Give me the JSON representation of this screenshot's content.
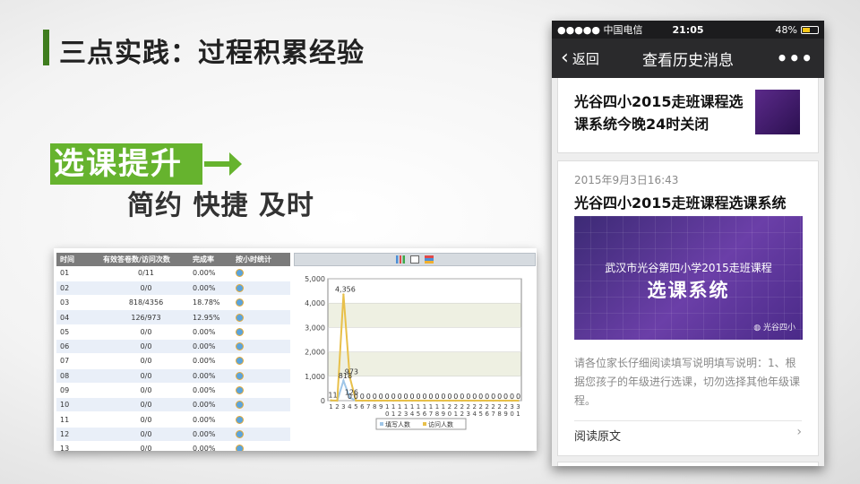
{
  "slide": {
    "title": "三点实践：过程积累经验",
    "highlight": "选课提升",
    "subtitle": "简约 快捷 及时"
  },
  "table": {
    "headers": [
      "时间",
      "有效答卷数/访问次数",
      "完成率",
      "按小时统计"
    ],
    "rows": [
      [
        "01",
        "0/11",
        "0.00%"
      ],
      [
        "02",
        "0/0",
        "0.00%"
      ],
      [
        "03",
        "818/4356",
        "18.78%"
      ],
      [
        "04",
        "126/973",
        "12.95%"
      ],
      [
        "05",
        "0/0",
        "0.00%"
      ],
      [
        "06",
        "0/0",
        "0.00%"
      ],
      [
        "07",
        "0/0",
        "0.00%"
      ],
      [
        "08",
        "0/0",
        "0.00%"
      ],
      [
        "09",
        "0/0",
        "0.00%"
      ],
      [
        "10",
        "0/0",
        "0.00%"
      ],
      [
        "11",
        "0/0",
        "0.00%"
      ],
      [
        "12",
        "0/0",
        "0.00%"
      ],
      [
        "13",
        "0/0",
        "0.00%"
      ]
    ]
  },
  "chart_data": {
    "type": "line",
    "x": [
      "1",
      "2",
      "3",
      "4",
      "5",
      "6",
      "7",
      "8",
      "9",
      "10",
      "11",
      "12",
      "13",
      "14",
      "15",
      "16",
      "17",
      "18",
      "19",
      "20",
      "21",
      "22",
      "23",
      "24",
      "25",
      "26",
      "27",
      "28",
      "29",
      "30",
      "31"
    ],
    "ylim": [
      0,
      5000
    ],
    "yticks": [
      "0",
      "1,000",
      "2,000",
      "3,000",
      "4,000",
      "5,000"
    ],
    "series": [
      {
        "name": "填写人数",
        "color": "#9fc6e8",
        "values": [
          0,
          0,
          818,
          126,
          0,
          0,
          0,
          0,
          0,
          0,
          0,
          0,
          0,
          0,
          0,
          0,
          0,
          0,
          0,
          0,
          0,
          0,
          0,
          0,
          0,
          0,
          0,
          0,
          0,
          0,
          0
        ]
      },
      {
        "name": "访问人数",
        "color": "#e8c04a",
        "values": [
          11,
          0,
          4356,
          973,
          0,
          0,
          0,
          0,
          0,
          0,
          0,
          0,
          0,
          0,
          0,
          0,
          0,
          0,
          0,
          0,
          0,
          0,
          0,
          0,
          0,
          0,
          0,
          0,
          0,
          0,
          0
        ]
      }
    ],
    "data_labels": [
      "4,356",
      "818",
      "973",
      "126",
      "11"
    ],
    "zero_label": "0"
  },
  "phone": {
    "carrier": "●●●●● 中国电信",
    "time": "21:05",
    "battery": "48%",
    "back": "返回",
    "nav_title": "查看历史消息",
    "more": "•••",
    "msg1_title": "光谷四小2015走班课程选课系统今晚24时关闭",
    "msg2_date": "2015年9月3日16:43",
    "msg2_title": "光谷四小2015走班课程选课系统",
    "banner_line1": "武汉市光谷第四小学2015走班课程",
    "banner_line2": "选课系统",
    "banner_watermark": "光谷四小",
    "msg2_desc": "请各位家长仔细阅读填写说明填写说明：1、根据您孩子的年级进行选课，切勿选择其他年级课程。",
    "read_more": "阅读原文"
  }
}
